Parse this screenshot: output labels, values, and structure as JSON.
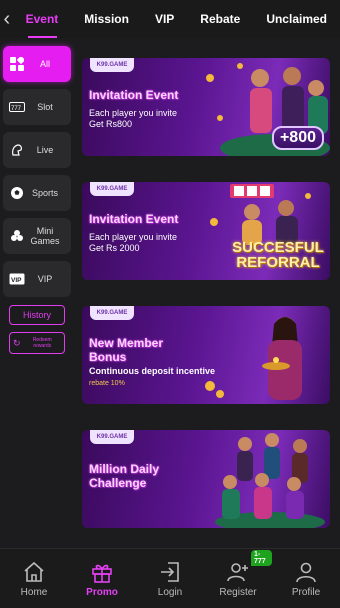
{
  "tabs": [
    "Event",
    "Mission",
    "VIP",
    "Rebate",
    "Unclaimed"
  ],
  "sidebar": {
    "items": [
      {
        "label": "All",
        "icon": "grid-icon",
        "active": true
      },
      {
        "label": "Slot",
        "icon": "slot-icon"
      },
      {
        "label": "Live",
        "icon": "live-icon"
      },
      {
        "label": "Sports",
        "icon": "soccer-icon"
      },
      {
        "label": "Mini Games",
        "icon": "clover-icon"
      },
      {
        "label": "VIP",
        "icon": "vip-icon"
      }
    ],
    "history_label": "History",
    "redeem_label": "Redeem rewards"
  },
  "cards": [
    {
      "brand": "K99.GAME",
      "title": "Invitation Event",
      "desc1": "Each player you invite",
      "desc2": "Get Rs800",
      "art_text": "+800"
    },
    {
      "brand": "K99.GAME",
      "title": "Invitation Event",
      "desc1": "Each player you invite",
      "desc2": "Get Rs 2000",
      "art_text": "SUCCESFUL REFORRAL"
    },
    {
      "brand": "K99.GAME",
      "title": "New Member Bonus",
      "desc1": "Continuous deposit incentive",
      "desc2": "rebate 10%",
      "art_text": ""
    },
    {
      "brand": "K99.GAME",
      "title": "Million Daily Challenge",
      "desc1": "",
      "desc2": "",
      "art_text": ""
    }
  ],
  "bottom_nav": [
    {
      "label": "Home",
      "icon": "home-icon"
    },
    {
      "label": "Promo",
      "icon": "gift-icon",
      "active": true
    },
    {
      "label": "Login",
      "icon": "login-icon"
    },
    {
      "label": "Register",
      "icon": "add-user-icon",
      "badge": "1-777"
    },
    {
      "label": "Profile",
      "icon": "user-icon"
    }
  ],
  "colors": {
    "accent": "#e51df0",
    "background": "#1c1c1e",
    "card": "#5a1590"
  }
}
